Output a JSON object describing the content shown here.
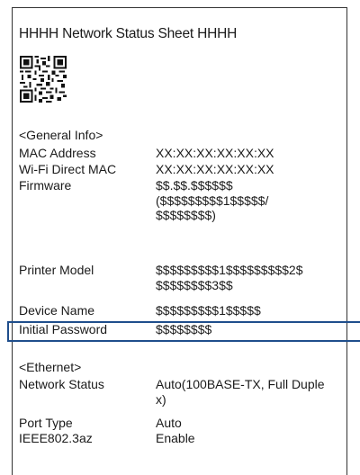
{
  "sheet": {
    "title": "HHHH Network Status Sheet HHHH",
    "qr_icon": "qr-code-icon"
  },
  "general": {
    "heading": "<General Info>",
    "rows": [
      {
        "label": "MAC Address",
        "value": "XX:XX:XX:XX:XX:XX"
      },
      {
        "label": "Wi-Fi Direct MAC",
        "value": "XX:XX:XX:XX:XX:XX"
      },
      {
        "label": "Firmware",
        "value": "$$.$$.$$$$$$ ($$$$$$$$$1$$$$$/ $$$$$$$$)"
      },
      {
        "label": "Printer Model",
        "value": "$$$$$$$$$1$$$$$$$$$2$ $$$$$$$$3$$"
      },
      {
        "label": "Device Name",
        "value": "$$$$$$$$$1$$$$$"
      },
      {
        "label": "Initial Password",
        "value": "$$$$$$$$"
      }
    ]
  },
  "ethernet": {
    "heading": "<Ethernet>",
    "rows": [
      {
        "label": "Network Status",
        "value": "Auto(100BASE-TX, Full Duplex)"
      },
      {
        "label": "Port Type",
        "value": "Auto"
      },
      {
        "label": "IEEE802.3az",
        "value": "Enable"
      }
    ]
  },
  "colors": {
    "highlight": "#1f4e8c"
  }
}
